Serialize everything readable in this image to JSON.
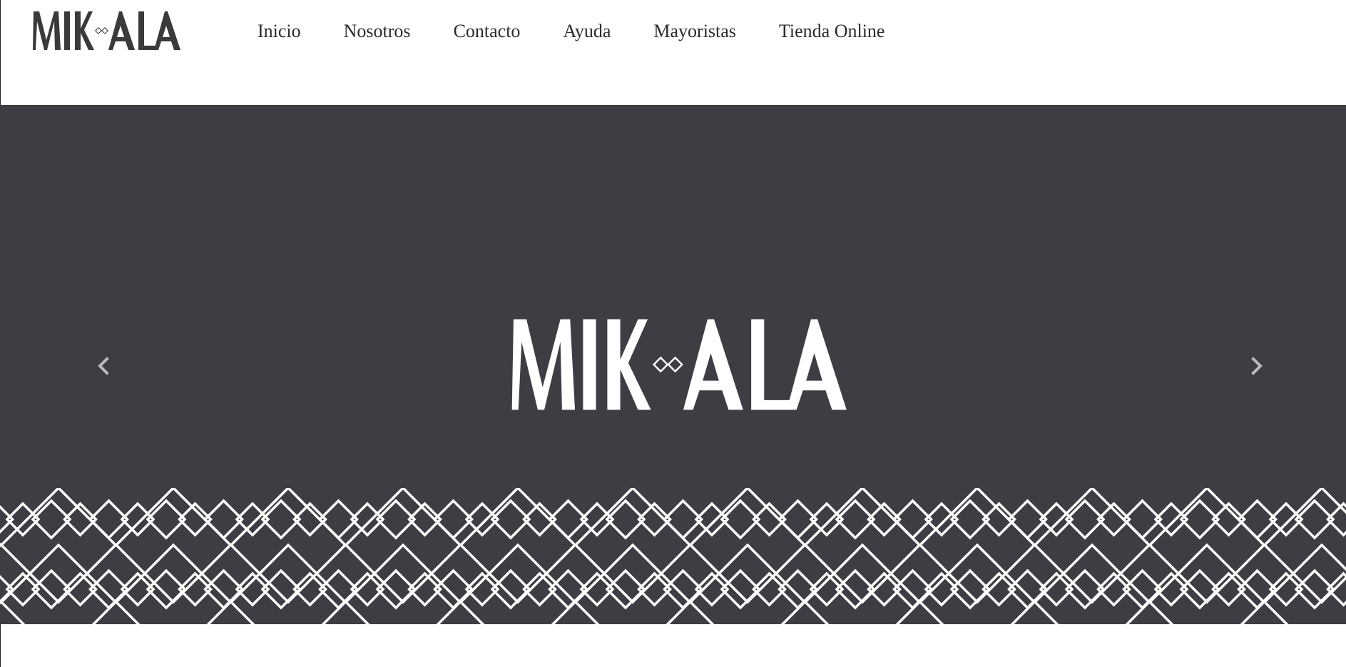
{
  "brand": {
    "logo_text": "MIKALA",
    "hero_logo_text": "MIKALA"
  },
  "nav": {
    "items": [
      {
        "label": "Inicio"
      },
      {
        "label": "Nosotros"
      },
      {
        "label": "Contacto"
      },
      {
        "label": "Ayuda"
      },
      {
        "label": "Mayoristas"
      },
      {
        "label": "Tienda Online"
      }
    ]
  },
  "hero": {
    "background_color": "#3e3d43",
    "foreground_color": "#ffffff",
    "prev_icon": "chevron-left-icon",
    "next_icon": "chevron-right-icon",
    "pattern_icon": "diamond-lattice-pattern"
  },
  "colors": {
    "page_background": "#ffffff",
    "nav_text": "#2b2b2b",
    "logo_dark": "#3a3a3a"
  }
}
